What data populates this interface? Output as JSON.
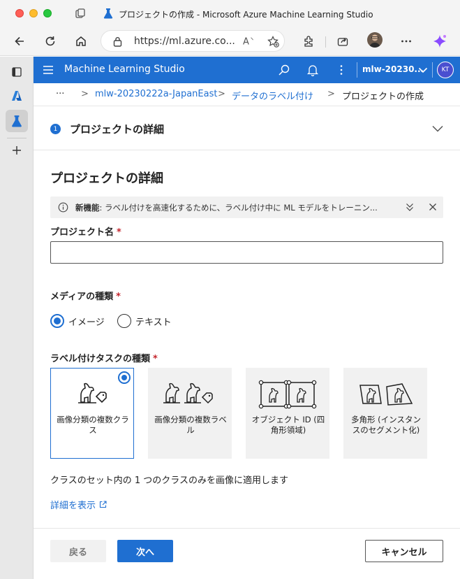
{
  "window": {
    "title": "プロジェクトの作成 - Microsoft Azure Machine Learning Studio"
  },
  "browser": {
    "url": "https://ml.azure.co..."
  },
  "app": {
    "title": "Machine Learning Studio",
    "workspace": "mlw-20230...",
    "avatar_initials": "KT",
    "brand_color": "#1f6fd1"
  },
  "breadcrumb": {
    "ellipsis": "···",
    "items": [
      "mlw-20230222a-JapanEast",
      "データのラベル付け",
      "プロジェクトの作成"
    ]
  },
  "step": {
    "number": "1",
    "title": "プロジェクトの詳細"
  },
  "section": {
    "title": "プロジェクトの詳細"
  },
  "banner": {
    "bold": "新機能",
    "text": ": ラベル付けを高速化するために、ラベル付け中に ML モデルをトレーニン..."
  },
  "form": {
    "project_name_label": "プロジェクト名",
    "project_name_value": "",
    "required_mark": "*",
    "media_type_label": "メディアの種類",
    "media_options": [
      "イメージ",
      "テキスト"
    ],
    "media_selected": "イメージ",
    "task_type_label": "ラベル付けタスクの種類",
    "task_options": [
      "画像分類の複数クラス",
      "画像分類の複数ラベル",
      "オブジェクト ID (四角形領域)",
      "多角形 (インスタンスのセグメント化)"
    ],
    "task_selected": "画像分類の複数クラス",
    "description": "クラスのセット内の 1 つのクラスのみを画像に適用します",
    "learn_more": "詳細を表示"
  },
  "footer": {
    "back": "戻る",
    "next": "次へ",
    "cancel": "キャンセル"
  }
}
